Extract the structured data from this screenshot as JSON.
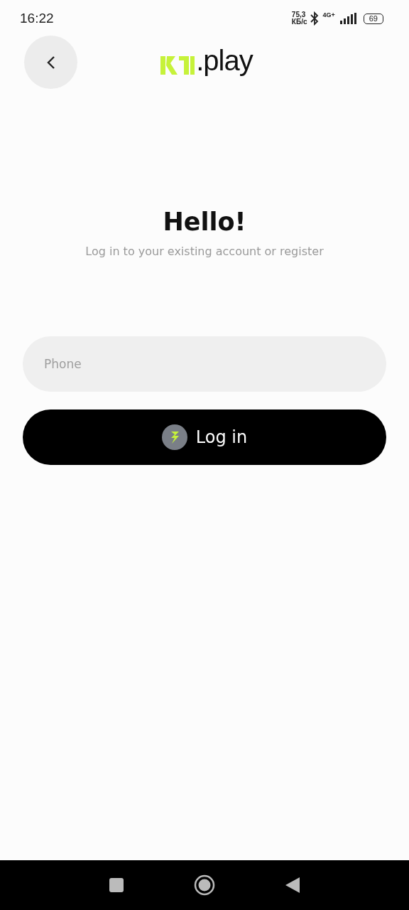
{
  "status_bar": {
    "time": "16:22",
    "speed": "75,3",
    "speed_unit": "КБ/с",
    "network": "4G+",
    "battery": "69"
  },
  "header": {
    "logo_text": ".play"
  },
  "title": "Hello!",
  "subtitle": "Log in to your existing account or register",
  "phone_field": {
    "placeholder": "Phone"
  },
  "login_button": {
    "label": "Log in"
  }
}
